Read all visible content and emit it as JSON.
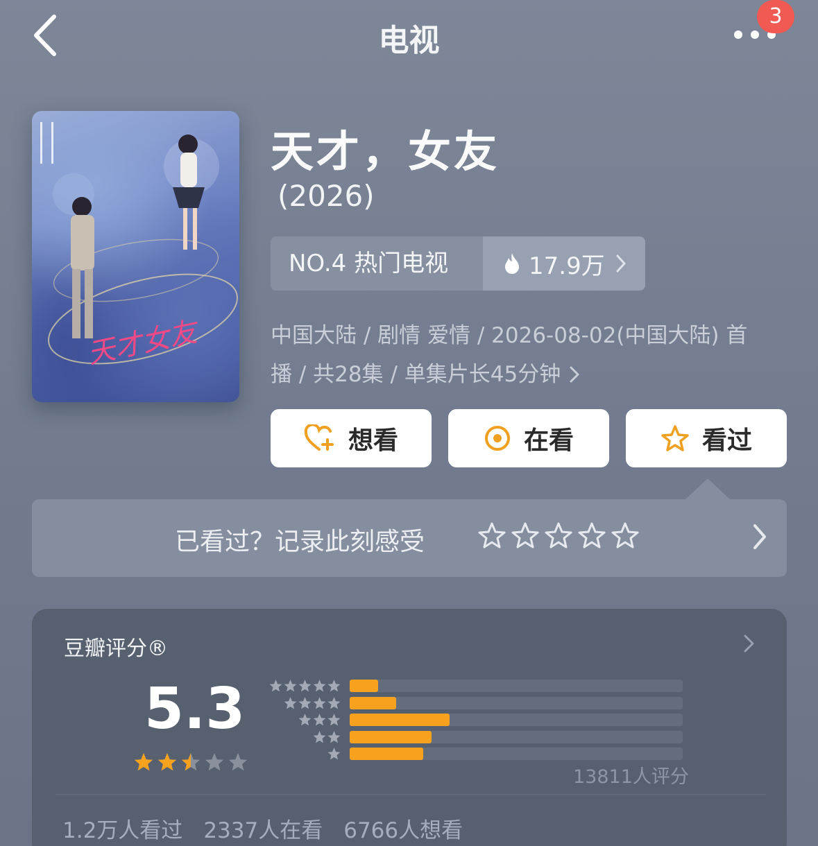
{
  "header": {
    "title": "电视",
    "back_icon": "chevron-left-icon",
    "more_icon": "more-dots-icon",
    "badge_count": "3"
  },
  "show": {
    "title": "天才，女友",
    "year": "(2026)",
    "poster_title": "天才女友"
  },
  "rank": {
    "label": "NO.4 热门电视",
    "heat_icon": "fire-icon",
    "heat_value": "17.9万"
  },
  "meta": {
    "line1": "中国大陆 / 剧情 爱情 / 2026-08-02(中国大陆) 首",
    "line2": "播 / 共28集 / 单集片长45分钟"
  },
  "actions": {
    "want": "想看",
    "watching": "在看",
    "watched": "看过"
  },
  "rate_prompt": {
    "text": "已看过？记录此刻感受"
  },
  "douban": {
    "title": "豆瓣评分®",
    "score": "5.3",
    "star_rating": 2.5,
    "distribution": [
      {
        "stars": 5,
        "fraction": 0.085
      },
      {
        "stars": 4,
        "fraction": 0.14
      },
      {
        "stars": 3,
        "fraction": 0.3
      },
      {
        "stars": 2,
        "fraction": 0.245
      },
      {
        "stars": 1,
        "fraction": 0.22
      }
    ],
    "rating_count": "13811人评分",
    "stats": [
      "1.2万人看过",
      "2337人在看",
      "6766人想看"
    ]
  },
  "colors": {
    "accent_orange": "#f6a21e",
    "badge_red": "#f05a52",
    "button_icon_orange": "#f0a020"
  }
}
